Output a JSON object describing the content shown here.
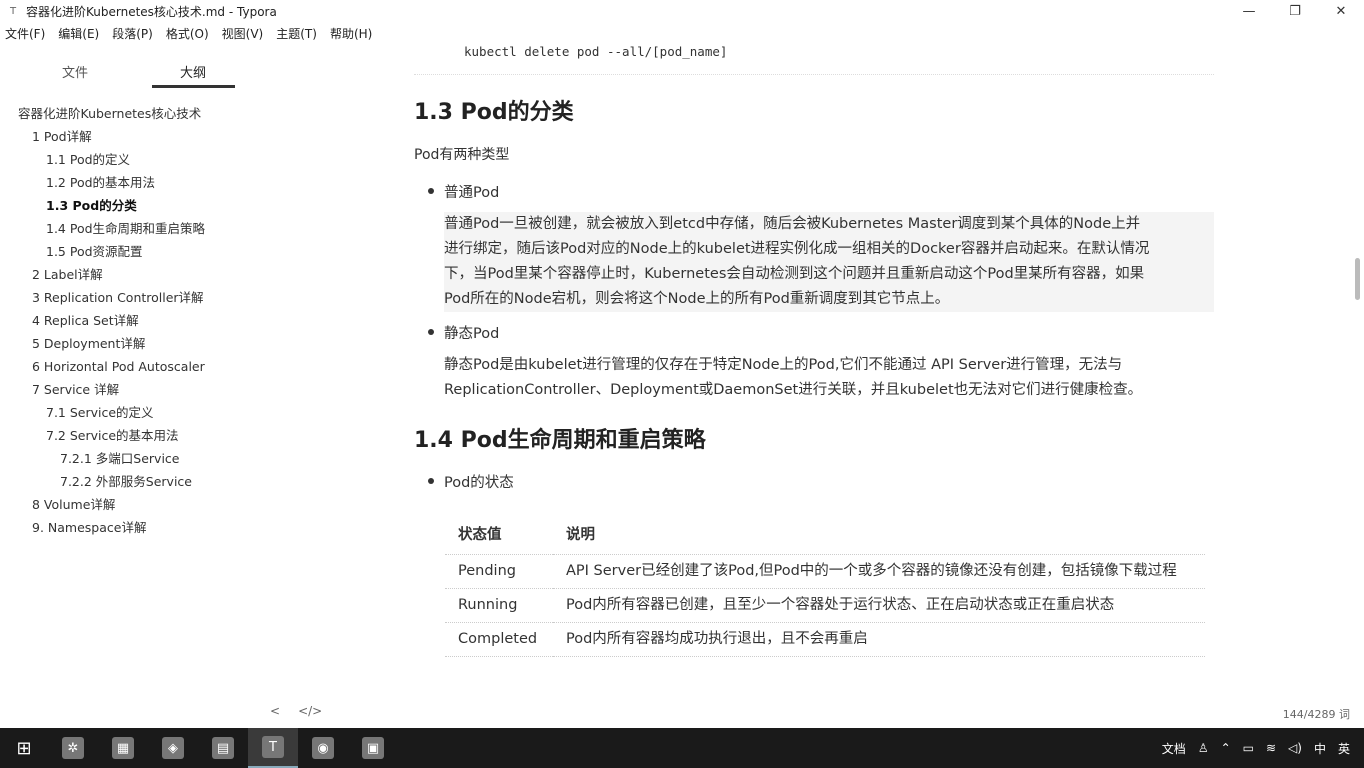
{
  "window": {
    "title": "容器化进阶Kubernetes核心技术.md - Typora",
    "icon": "T"
  },
  "menu": [
    "文件(F)",
    "编辑(E)",
    "段落(P)",
    "格式(O)",
    "视图(V)",
    "主题(T)",
    "帮助(H)"
  ],
  "sidebar": {
    "tabs": {
      "files": "文件",
      "outline": "大纲"
    },
    "outline": [
      {
        "label": "容器化进阶Kubernetes核心技术",
        "level": 0
      },
      {
        "label": "1 Pod详解",
        "level": 1
      },
      {
        "label": "1.1 Pod的定义",
        "level": 2
      },
      {
        "label": "1.2 Pod的基本用法",
        "level": 2
      },
      {
        "label": "1.3 Pod的分类",
        "level": 2,
        "active": true
      },
      {
        "label": "1.4 Pod生命周期和重启策略",
        "level": 2
      },
      {
        "label": "1.5 Pod资源配置",
        "level": 2
      },
      {
        "label": "2 Label详解",
        "level": 1
      },
      {
        "label": "3 Replication Controller详解",
        "level": 1
      },
      {
        "label": "4 Replica Set详解",
        "level": 1
      },
      {
        "label": "5 Deployment详解",
        "level": 1
      },
      {
        "label": "6 Horizontal Pod Autoscaler",
        "level": 1
      },
      {
        "label": "7 Service 详解",
        "level": 1
      },
      {
        "label": "7.1 Service的定义",
        "level": 2
      },
      {
        "label": "7.2 Service的基本用法",
        "level": 2
      },
      {
        "label": "7.2.1 多端口Service",
        "level": 3
      },
      {
        "label": "7.2.2 外部服务Service",
        "level": 3
      },
      {
        "label": "8 Volume详解",
        "level": 1
      },
      {
        "label": "9. Namespace详解",
        "level": 1
      }
    ],
    "footer": {
      "back": "<",
      "source": "</>"
    }
  },
  "content": {
    "code": "kubectl delete pod --all/[pod_name]",
    "h_13": "1.3 Pod的分类",
    "p_types": "Pod有两种类型",
    "bullet_normal": "普通Pod",
    "normal_lines": [
      "普通Pod一旦被创建，就会被放入到etcd中存储，随后会被Kubernetes Master调度到某个具体的Node上并",
      "进行绑定，随后该Pod对应的Node上的kubelet进程实例化成一组相关的Docker容器并启动起来。在默认情况",
      "下，当Pod里某个容器停止时，Kubernetes会自动检测到这个问题并且重新启动这个Pod里某所有容器，如果",
      "Pod所在的Node宕机，则会将这个Node上的所有Pod重新调度到其它节点上。"
    ],
    "bullet_static": "静态Pod",
    "static_lines": [
      "静态Pod是由kubelet进行管理的仅存在于特定Node上的Pod,它们不能通过 API Server进行管理，无法与",
      "ReplicationController、Deployment或DaemonSet进行关联，并且kubelet也无法对它们进行健康检查。"
    ],
    "h_14": "1.4 Pod生命周期和重启策略",
    "bullet_state": "Pod的状态",
    "table": {
      "headers": [
        "状态值",
        "说明"
      ],
      "rows": [
        [
          "Pending",
          "API Server已经创建了该Pod,但Pod中的一个或多个容器的镜像还没有创建，包括镜像下载过程"
        ],
        [
          "Running",
          "Pod内所有容器已创建，且至少一个容器处于运行状态、正在启动状态或正在重启状态"
        ],
        [
          "Completed",
          "Pod内所有容器均成功执行退出，且不会再重启"
        ]
      ]
    }
  },
  "status": {
    "word_count": "144/4289 词"
  },
  "taskbar": {
    "apps": [
      {
        "name": "start-icon",
        "glyph": "⊞"
      },
      {
        "name": "app-icon-1",
        "glyph": "✲"
      },
      {
        "name": "app-icon-2",
        "glyph": "▦"
      },
      {
        "name": "app-icon-3",
        "glyph": "◈"
      },
      {
        "name": "app-icon-4",
        "glyph": "▤"
      },
      {
        "name": "typora-icon",
        "glyph": "T",
        "active": true
      },
      {
        "name": "app-icon-6",
        "glyph": "◉"
      },
      {
        "name": "app-icon-7",
        "glyph": "▣"
      }
    ],
    "tray": {
      "docs": "文档",
      "ime": "中",
      "lang": "英"
    }
  }
}
